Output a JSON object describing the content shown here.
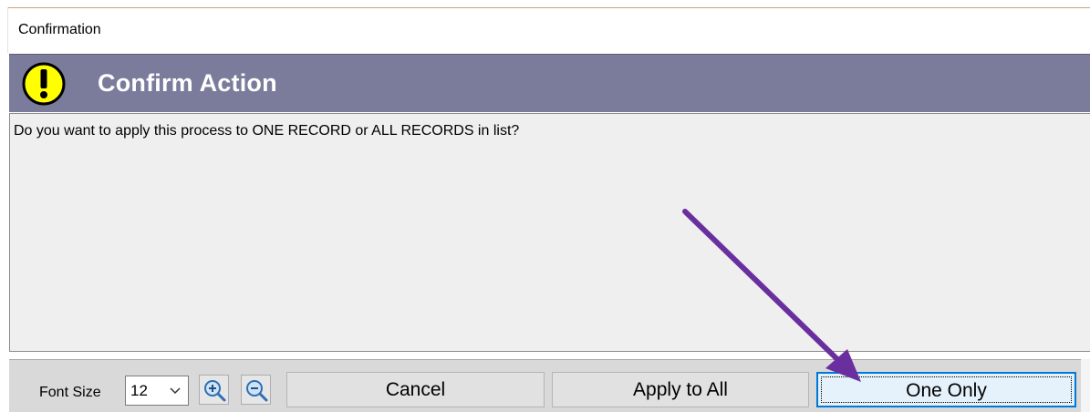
{
  "window": {
    "title": "Confirmation"
  },
  "header": {
    "title": "Confirm Action",
    "icon": "exclamation-warning-icon",
    "background_color": "#7b7b9c",
    "icon_color": "#ffff00"
  },
  "message": {
    "text": "Do you want to apply this process to ONE RECORD or ALL RECORDS in list?"
  },
  "footer": {
    "font_size_label": "Font Size",
    "font_size_value": "12",
    "zoom_in_icon": "zoom-in-icon",
    "zoom_out_icon": "zoom-out-icon",
    "buttons": {
      "cancel": "Cancel",
      "apply_all": "Apply to All",
      "one_only": "One Only"
    }
  },
  "annotation": {
    "type": "arrow",
    "color": "#6a2f9e",
    "points_to": "One Only"
  }
}
